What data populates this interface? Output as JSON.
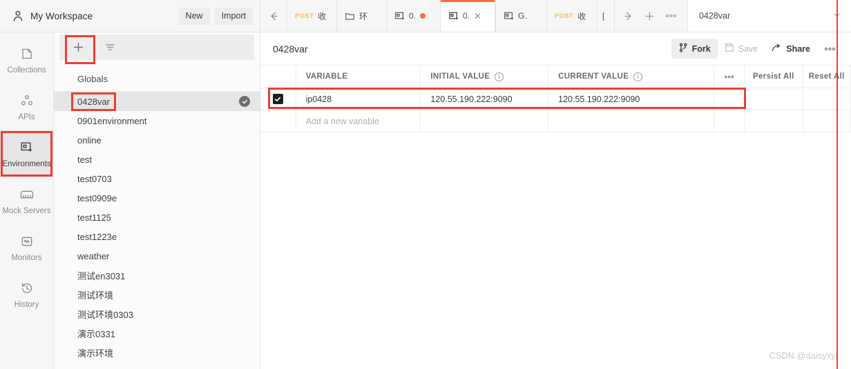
{
  "workspace": {
    "title": "My Workspace",
    "user_icon": "person-icon",
    "new_label": "New",
    "import_label": "Import"
  },
  "tabbar": {
    "back_icon": "arrow-left-icon",
    "tabs": [
      {
        "icon": "",
        "method": "POST",
        "label": "收",
        "close": "",
        "unsaved": false,
        "active": false
      },
      {
        "icon": "folder-icon",
        "method": "",
        "label": "环",
        "close": "",
        "unsaved": false,
        "active": false
      },
      {
        "icon": "environment-icon",
        "method": "",
        "label": "0.",
        "close": "",
        "unsaved": true,
        "active": false
      },
      {
        "icon": "environment-icon",
        "method": "",
        "label": "0.",
        "close": "✕",
        "unsaved": false,
        "active": true
      },
      {
        "icon": "environment-icon",
        "method": "",
        "label": "G.",
        "close": "",
        "unsaved": false,
        "active": false
      },
      {
        "icon": "",
        "method": "POST",
        "label": "收",
        "close": "",
        "unsaved": false,
        "active": false
      },
      {
        "icon": "",
        "method": "",
        "label": "[",
        "close": "",
        "unsaved": false,
        "active": false
      }
    ],
    "actions": [
      {
        "name": "forward-arrow-icon",
        "glyph": "→"
      },
      {
        "name": "new-tab-icon",
        "glyph": "＋"
      },
      {
        "name": "more-options-icon",
        "glyph": "○○○"
      }
    ],
    "environment_selector": {
      "value": "0428var",
      "chevron": "chevron-down-icon"
    }
  },
  "rail": {
    "items": [
      {
        "label": "Collections",
        "icon": "collections-icon",
        "active": false
      },
      {
        "label": "APIs",
        "icon": "apis-icon",
        "active": false
      },
      {
        "label": "Environments",
        "icon": "environments-icon",
        "active": true
      },
      {
        "label": "Mock Servers",
        "icon": "mock-servers-icon",
        "active": false
      },
      {
        "label": "Monitors",
        "icon": "monitors-icon",
        "active": false
      },
      {
        "label": "History",
        "icon": "history-icon",
        "active": false
      }
    ]
  },
  "env_panel": {
    "add_icon": "plus-icon",
    "filter_icon": "filter-icon",
    "globals_label": "Globals",
    "items": [
      {
        "name": "0428var",
        "selected": true,
        "active_check": true
      },
      {
        "name": "0901environment",
        "selected": false,
        "active_check": false
      },
      {
        "name": "online",
        "selected": false,
        "active_check": false
      },
      {
        "name": "test",
        "selected": false,
        "active_check": false
      },
      {
        "name": "test0703",
        "selected": false,
        "active_check": false
      },
      {
        "name": "test0909e",
        "selected": false,
        "active_check": false
      },
      {
        "name": "test1125",
        "selected": false,
        "active_check": false
      },
      {
        "name": "test1223e",
        "selected": false,
        "active_check": false
      },
      {
        "name": "weather",
        "selected": false,
        "active_check": false
      },
      {
        "name": "测试en3031",
        "selected": false,
        "active_check": false
      },
      {
        "name": "测试环境",
        "selected": false,
        "active_check": false
      },
      {
        "name": "测试环境0303",
        "selected": false,
        "active_check": false
      },
      {
        "name": "演示0331",
        "selected": false,
        "active_check": false
      },
      {
        "name": "演示环境",
        "selected": false,
        "active_check": false
      }
    ]
  },
  "main": {
    "title": "0428var",
    "actions": {
      "fork": "Fork",
      "save": "Save",
      "share": "Share",
      "more": "○○○"
    },
    "table": {
      "headers": {
        "variable": "VARIABLE",
        "initial_value": "INITIAL VALUE",
        "current_value": "CURRENT VALUE",
        "more": "○○○",
        "persist_all": "Persist All",
        "reset_all": "Reset All"
      },
      "rows": [
        {
          "checked": true,
          "check_glyph": "✔",
          "variable": "ip0428",
          "initial_value": "120.55.190.222:9090",
          "current_value": "120.55.190.222:9090"
        }
      ],
      "add_row_placeholder": "Add a new variable"
    }
  },
  "watermark": "CSDN @daisyxyr",
  "colors": {
    "accent": "#ff6c37",
    "annotation": "#f03c32",
    "method_post": "#ffb84d",
    "panel_bg": "#f6f6f6"
  }
}
